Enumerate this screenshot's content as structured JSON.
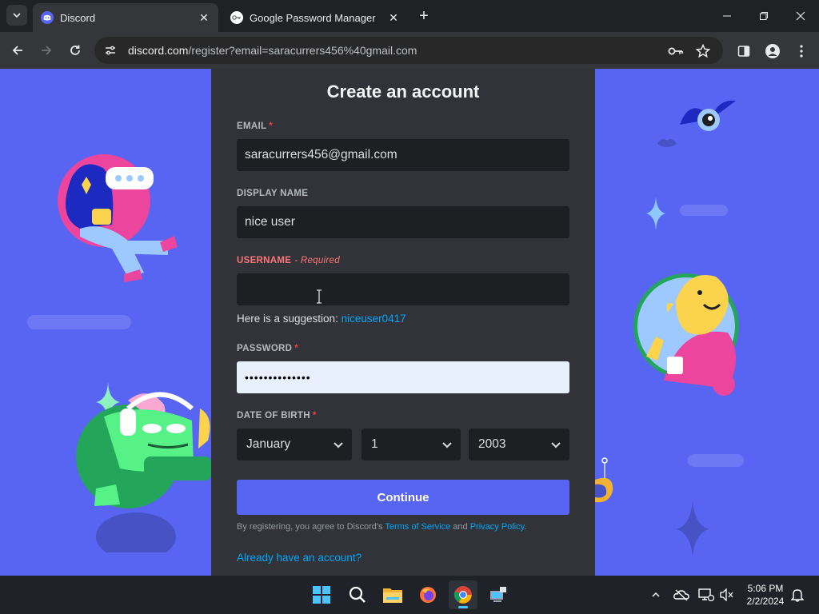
{
  "browser": {
    "tabs": [
      {
        "title": "Discord",
        "active": true
      },
      {
        "title": "Google Password Manager",
        "active": false
      }
    ],
    "url": {
      "host": "discord.com",
      "path": "/register?email=saracurrers456%40gmail.com"
    }
  },
  "form": {
    "title": "Create an account",
    "email": {
      "label": "EMAIL",
      "required_mark": "*",
      "value": "saracurrers456@gmail.com"
    },
    "display_name": {
      "label": "DISPLAY NAME",
      "value": "nice user"
    },
    "username": {
      "label": "USERNAME",
      "error_note": "- Required",
      "value": ""
    },
    "suggestion": {
      "prefix": "Here is a suggestion: ",
      "value": "niceuser0417"
    },
    "password": {
      "label": "PASSWORD",
      "required_mark": "*",
      "value": "••••••••••••••"
    },
    "dob": {
      "label": "DATE OF BIRTH",
      "required_mark": "*",
      "month": "January",
      "day": "1",
      "year": "2003"
    },
    "continue_label": "Continue",
    "terms": {
      "prefix": "By registering, you agree to Discord's ",
      "tos": "Terms of Service",
      "and": " and ",
      "privacy": "Privacy Policy",
      "suffix": "."
    },
    "login_link": "Already have an account?"
  },
  "taskbar": {
    "time": "5:06 PM",
    "date": "2/2/2024"
  },
  "colors": {
    "brand": "#5865f2",
    "card": "#313338",
    "input": "#1e1f22",
    "link": "#00a8fc",
    "error": "#fa777c"
  }
}
